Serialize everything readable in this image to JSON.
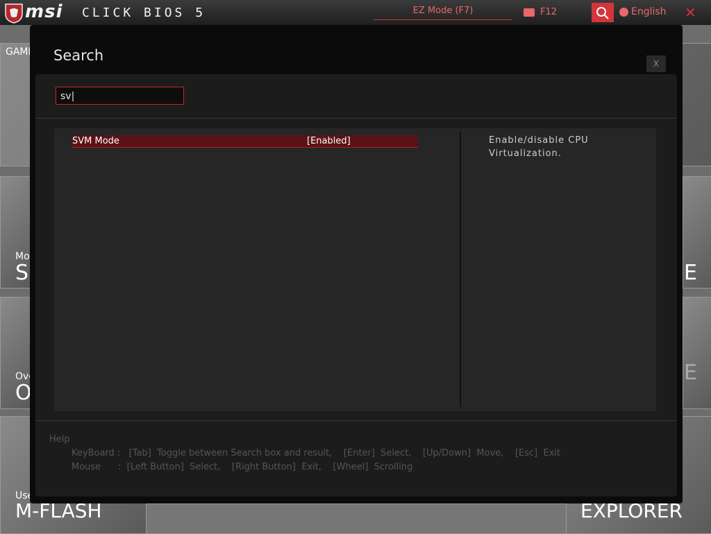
{
  "header": {
    "brand": "msi",
    "product": "CLICK BIOS 5",
    "ez_mode": "EZ Mode (F7)",
    "screenshot_key": "F12",
    "language": "English"
  },
  "background": {
    "labels": {
      "gami": "GAMI",
      "mo": "Mo",
      "ove": "Ove",
      "use": "Use"
    },
    "big": {
      "s": "SI",
      "o": "O",
      "mflash": "M-FLASH",
      "explorer": "EXPLORER",
      "e1": "E",
      "e2": "E"
    }
  },
  "dialog": {
    "title": "Search",
    "close_label": "X",
    "search_value": "sv|",
    "results": [
      {
        "label": "SVM Mode",
        "value": "[Enabled]"
      }
    ],
    "help_text": "Enable/disable CPU Virtualization.",
    "help": {
      "heading": "Help",
      "keyboard": "KeyBoard :   [Tab]  Toggle between Search box and result,    [Enter]  Select,    [Up/Down]  Move,    [Esc]  Exit",
      "mouse": "Mouse      :  [Left Button]  Select,    [Right Button]  Exit,    [Wheel]  Scrolling"
    }
  },
  "colors": {
    "accent": "#d4343a",
    "selected_row": "#5b1215"
  }
}
